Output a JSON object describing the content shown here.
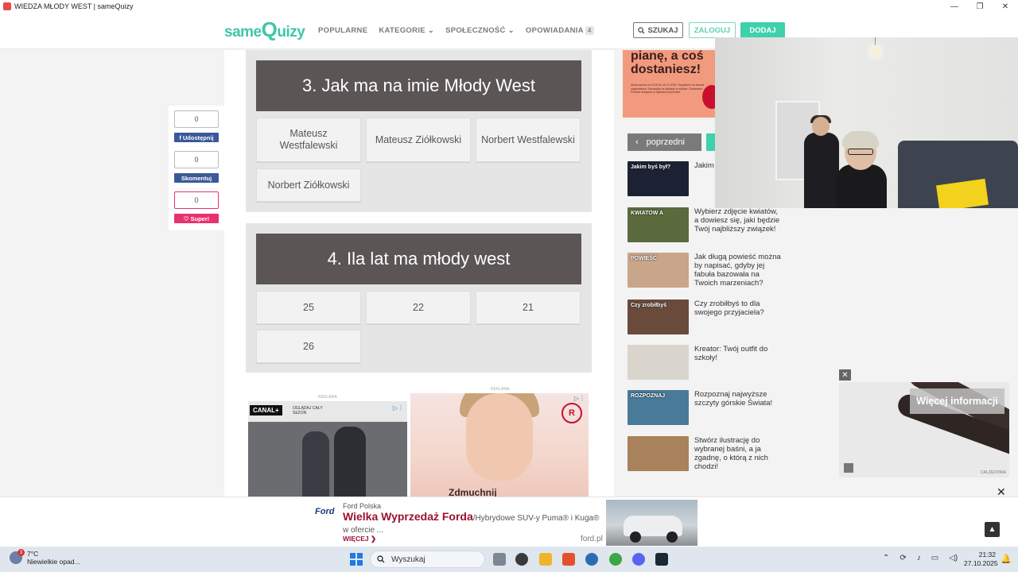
{
  "window": {
    "title": "WIEDZA MŁODY WEST | sameQuizy",
    "min": "—",
    "max": "❐",
    "close": "✕"
  },
  "header": {
    "logo_pre": "same",
    "logo_q": "Q",
    "logo_post": "uizy",
    "nav": [
      {
        "label": "POPULARNE"
      },
      {
        "label": "KATEGORIE",
        "chevron": "⌄"
      },
      {
        "label": "SPOŁECZNOŚĆ",
        "chevron": "⌄"
      },
      {
        "label": "OPOWIADANIA",
        "badge": "4"
      }
    ],
    "search_label": "SZUKAJ",
    "login_label": "ZALOGUJ",
    "add_label": "DODAJ"
  },
  "share": {
    "share_count": "0",
    "share_label": "Udostępnij",
    "comment_count": "0",
    "comment_label": "Skomentuj",
    "super_count": "0",
    "super_label": "Super!",
    "colors": {
      "share": "#3b5998",
      "comment": "#3b5998",
      "super": "#e8316f"
    }
  },
  "questions": [
    {
      "title": "3. Jak ma na imie Młody West",
      "answers": [
        "Mateusz Westfalewski",
        "Mateusz Ziółkowski",
        "Norbert Westfalewski",
        "Norbert Ziółkowski"
      ]
    },
    {
      "title": "4. Ila lat ma młody west",
      "answers": [
        "25",
        "22",
        "21",
        "26"
      ]
    }
  ],
  "ads": {
    "label": "REKLAMA",
    "canal_brand": "CANAL+",
    "canal_tag": "OGLĄDAJ CAŁY SEZON",
    "beauty_text": "Zdmuchnij",
    "top_right_headline": "pianę, a coś dostaniesz!",
    "top_right_fine": "Akcja ważna od 13.09 do 15.11.2025. Regulamin na stronie organizatora. Szczegóły na plakacie w sklepie. Rossmann. Produkt dostępny w ograniczonej liczbie.",
    "video_more": "Więcej informacji",
    "video_brand": "CALZEDONIA"
  },
  "sidebar": {
    "prev_label": "poprzedni",
    "items": [
      {
        "text": "Jakim byś by",
        "thumb_text": "Jakim byś był?",
        "color": "#1c2233"
      },
      {
        "text": "Wybierz zdjęcie kwiatów, a dowiesz się, jaki będzie Twój najbliższy związek!",
        "thumb_text": "KWIATOW A",
        "color": "#5b6b3d"
      },
      {
        "text": "Jak długą powieść można by napisać, gdyby jej fabuła bazowała na Twoich marzeniach?",
        "thumb_text": "POWIEŚĆ",
        "color": "#c9a58a"
      },
      {
        "text": "Czy zrobiłbyś to dla swojego przyjaciela?",
        "thumb_text": "Czy zrobiłbyś",
        "color": "#6a4a3a"
      },
      {
        "text": "Kreator: Twój outfit do szkoły!",
        "thumb_text": "",
        "color": "#d9d4cc"
      },
      {
        "text": "Rozpoznaj najwyższe szczyty górskie Świata!",
        "thumb_text": "ROZPOZNAJ",
        "color": "#4a7a9a"
      },
      {
        "text": "Stwórz ilustrację do wybranej baśni, a ja zgadnę, o którą z nich chodzi!",
        "thumb_text": "",
        "color": "#a8825a"
      }
    ]
  },
  "bottom_ad": {
    "ford_logo": "Ford",
    "advertiser": "Ford Polska",
    "headline": "Wielka Wyprzedaż Forda",
    "sub": "/Hybrydowe SUV-y Puma® i Kuga® w ofercie ...",
    "cta": "WIĘCEJ ❯",
    "domain": "ford.pl",
    "close": "✕",
    "scroll_top": "▲"
  },
  "taskbar": {
    "weather_temp": "7°C",
    "weather_desc": "Niewielkie opad...",
    "weather_badge": "3",
    "search_label": "Wyszukaj",
    "time": "21:32",
    "date": "27.10.2025"
  }
}
